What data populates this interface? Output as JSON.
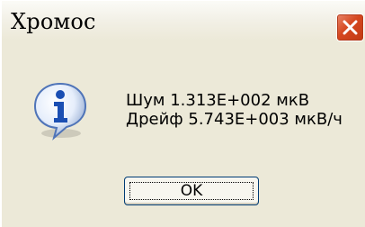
{
  "window": {
    "title": "Хромос",
    "close_icon": "close-x-icon",
    "accent_color": "#d5471f"
  },
  "message": {
    "icon": "info-icon",
    "line1": "Шум 1.313E+002 мкВ",
    "line2": "Дрейф 5.743E+003 мкВ/ч"
  },
  "buttons": {
    "ok_label": "OK"
  }
}
